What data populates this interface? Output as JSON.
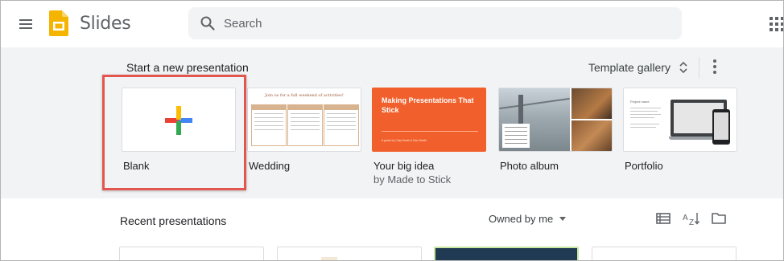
{
  "app": {
    "title": "Slides"
  },
  "search": {
    "placeholder": "Search"
  },
  "templates_section": {
    "title": "Start a new presentation",
    "gallery_label": "Template gallery",
    "items": [
      {
        "name": "Blank"
      },
      {
        "name": "Wedding",
        "thumb_text": "Join us for a full weekend of activities!"
      },
      {
        "name": "Your big idea",
        "subtitle": "by Made to Stick",
        "thumb_text": "Making Presentations That Stick",
        "thumb_small": "A guide by Chip Heath & Dan Heath"
      },
      {
        "name": "Photo album"
      },
      {
        "name": "Portfolio",
        "thumb_text": "Project name"
      }
    ]
  },
  "recent_section": {
    "title": "Recent presentations",
    "owner_filter": "Owned by me"
  },
  "colors": {
    "highlight_border": "#e2564f",
    "band_background": "#f1f3f4",
    "slides_yellow": "#f4b400",
    "big_idea_orange": "#f1602c"
  },
  "icons": [
    "hamburger-menu-icon",
    "slides-logo-icon",
    "search-icon",
    "apps-grid-icon",
    "sort-updown-icon",
    "more-vert-icon",
    "list-view-icon",
    "sort-az-icon",
    "folder-icon",
    "plus-icon"
  ]
}
